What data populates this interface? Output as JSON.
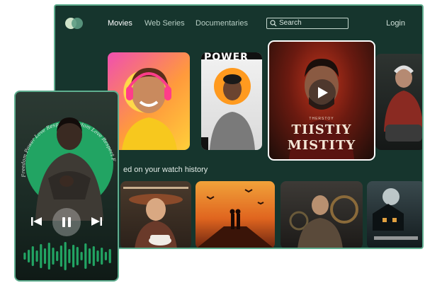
{
  "nav": {
    "links": [
      "Movies",
      "Web Series",
      "Documentaries"
    ],
    "search_placeholder": "Search",
    "login": "Login"
  },
  "posters_row1": {
    "power_title": "POWER",
    "featured_subtitle": "THERSTOY",
    "featured_title_line1": "TIISTIY",
    "featured_title_line2": "MISTITY"
  },
  "section": {
    "title": "ed on your watch history"
  },
  "phone": {
    "arc_text": "Freedom Power Love Respect Freedom Love Respect Freedom",
    "wave_levels": [
      0.25,
      0.45,
      0.7,
      0.4,
      0.85,
      0.55,
      0.95,
      0.6,
      0.35,
      0.75,
      1.0,
      0.5,
      0.8,
      0.65,
      0.3,
      0.9,
      0.55,
      0.7,
      0.4,
      0.6,
      0.3,
      0.5
    ]
  },
  "colors": {
    "app_bg": "#16352d",
    "accent_border": "#5fae8f",
    "player_green": "#22a463"
  }
}
